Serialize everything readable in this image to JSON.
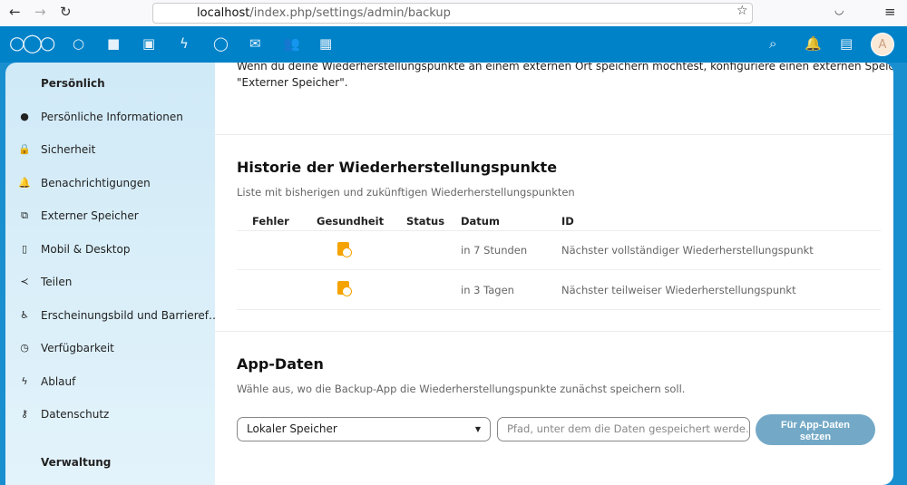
{
  "browser": {
    "url_host": "localhost",
    "url_path": "/index.php/settings/admin/backup"
  },
  "header": {
    "apps": [
      "dashboard",
      "files",
      "photos",
      "activity",
      "talk",
      "mail",
      "contacts",
      "calendar"
    ],
    "avatar_letter": "A"
  },
  "sidebar": {
    "section_personal": "Persönlich",
    "section_admin": "Verwaltung",
    "items": [
      {
        "label": "Persönliche Informationen",
        "icon": "person-icon"
      },
      {
        "label": "Sicherheit",
        "icon": "lock-icon"
      },
      {
        "label": "Benachrichtigungen",
        "icon": "bell-icon"
      },
      {
        "label": "Externer Speicher",
        "icon": "external-icon"
      },
      {
        "label": "Mobil & Desktop",
        "icon": "phone-icon"
      },
      {
        "label": "Teilen",
        "icon": "share-icon"
      },
      {
        "label": "Erscheinungsbild und Barrieref…",
        "icon": "accessibility-icon"
      },
      {
        "label": "Verfügbarkeit",
        "icon": "clock-icon"
      },
      {
        "label": "Ablauf",
        "icon": "flow-icon"
      },
      {
        "label": "Datenschutz",
        "icon": "key-icon"
      }
    ]
  },
  "intro": {
    "line1": "Wenn du deine Wiederherstellungspunkte an einem externen Ort speichern möchtest, konfiguriere einen externen Speicher in der App",
    "line2": "\"Externer Speicher\"."
  },
  "history": {
    "title": "Historie der Wiederherstellungspunkte",
    "subtitle": "Liste mit bisherigen und zukünftigen Wiederherstellungspunkten",
    "columns": [
      "Fehler",
      "Gesundheit",
      "Status",
      "Datum",
      "ID"
    ],
    "rows": [
      {
        "health": "pending-icon",
        "date": "in 7 Stunden",
        "id": "Nächster vollständiger Wiederherstellungspunkt"
      },
      {
        "health": "pending-icon",
        "date": "in 3 Tagen",
        "id": "Nächster teilweiser Wiederherstellungspunkt"
      }
    ]
  },
  "appdata": {
    "title": "App-Daten",
    "subtitle": "Wähle aus, wo die Backup-App die Wiederherstellungspunkte zunächst speichern soll.",
    "select_value": "Lokaler Speicher",
    "path_placeholder": "Pfad, unter dem die Daten gespeichert werde…",
    "button_line1": "Für App-Daten",
    "button_line2": "setzen"
  },
  "colors": {
    "header": "#0082c9",
    "warning": "#f4a300",
    "button": "#73a9c6"
  }
}
